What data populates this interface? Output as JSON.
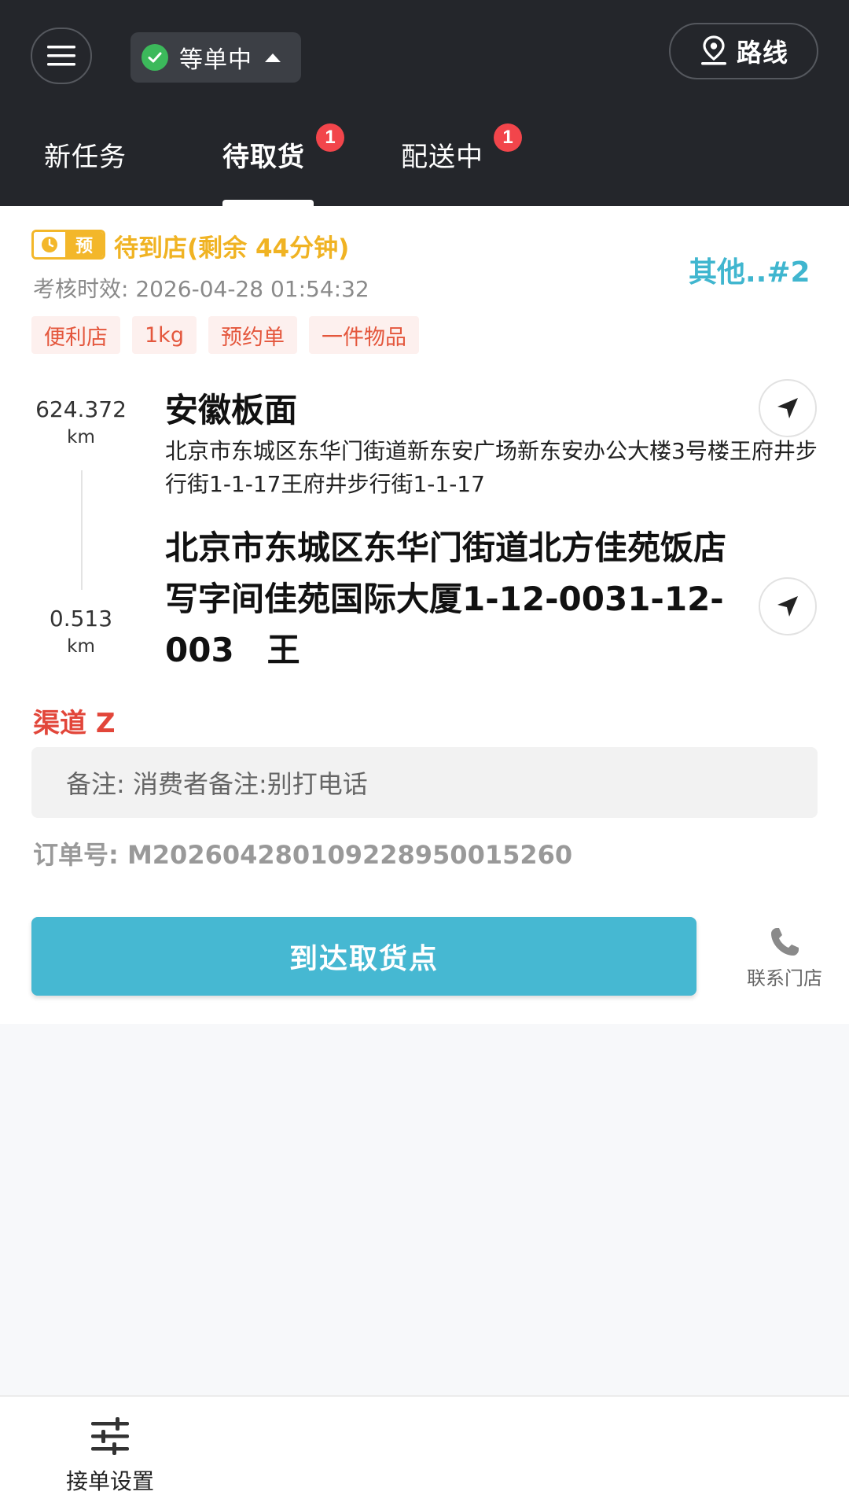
{
  "header": {
    "status": "等单中",
    "route_label": "路线",
    "tabs": [
      {
        "label": "新任务"
      },
      {
        "label": "待取货",
        "badge": "1"
      },
      {
        "label": "配送中",
        "badge": "1"
      }
    ],
    "active_tab": "待取货"
  },
  "order": {
    "pre_label": "预",
    "wait_status": "待到店(剩余 44分钟)",
    "sequence": "其他..#2",
    "deadline": "考核时效: 2026-04-28 01:54:32",
    "tags": [
      "便利店",
      "1kg",
      "预约单",
      "一件物品"
    ],
    "shop": {
      "distance": "624.372",
      "distance_unit": "km",
      "name": "安徽板面",
      "address": "北京市东城区东华门街道新东安广场新东安办公大楼3号楼王府井步行街1-1-17王府井步行街1-1-17"
    },
    "destination": {
      "distance": "0.513",
      "distance_unit": "km",
      "address": "北京市东城区东华门街道北方佳苑饭店写字间佳苑国际大厦1-12-0031-12-003　王"
    },
    "channel": "渠道 Z",
    "note": "备注: 消费者备注:别打电话",
    "order_number": "订单号: M202604280109228950015260",
    "action_label": "到达取货点",
    "contact_label": "联系门店"
  },
  "bottom": {
    "settings_label": "接单设置"
  },
  "colors": {
    "header_bg": "#24262b",
    "accent_teal": "#46b8d2",
    "warning_yellow": "#f3b72a",
    "alert_red": "#e2463a",
    "badge_red": "#f2454b",
    "status_green": "#3cb95b"
  },
  "icons": {
    "menu": "menu-icon",
    "status": "check-circle-icon",
    "route": "map-pin-icon",
    "clock": "clock-icon",
    "navigate": "navigation-arrow-icon",
    "phone": "phone-icon",
    "settings": "sliders-icon"
  }
}
